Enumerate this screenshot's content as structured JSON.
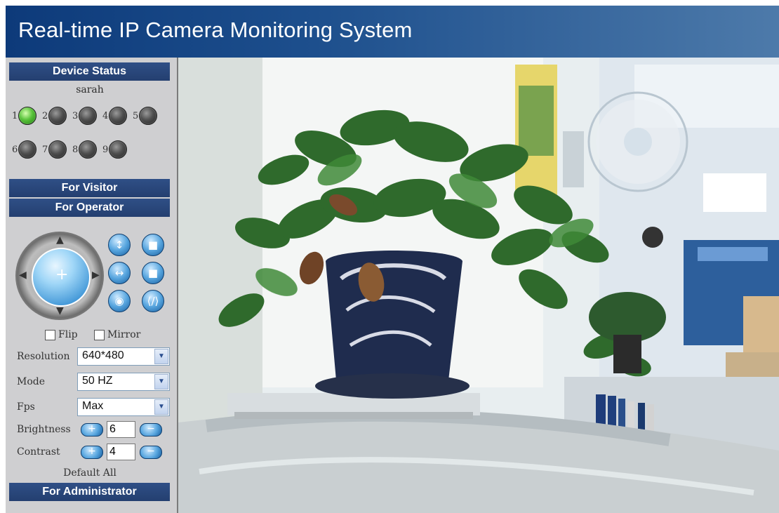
{
  "app": {
    "title": "Real-time IP Camera Monitoring System"
  },
  "sidebar": {
    "device_status": {
      "header": "Device Status",
      "user": "sarah",
      "devices": [
        {
          "num": "1",
          "status": "online"
        },
        {
          "num": "2",
          "status": "offline"
        },
        {
          "num": "3",
          "status": "offline"
        },
        {
          "num": "4",
          "status": "offline"
        },
        {
          "num": "5",
          "status": "offline"
        },
        {
          "num": "6",
          "status": "offline"
        },
        {
          "num": "7",
          "status": "offline"
        },
        {
          "num": "8",
          "status": "offline"
        },
        {
          "num": "9",
          "status": "offline"
        }
      ]
    },
    "for_visitor": "For Visitor",
    "for_operator": "For Operator",
    "for_administrator": "For Administrator",
    "operator": {
      "flip_label": "Flip",
      "mirror_label": "Mirror",
      "resolution_label": "Resolution",
      "resolution_value": "640*480",
      "mode_label": "Mode",
      "mode_value": "50 HZ",
      "fps_label": "Fps",
      "fps_value": "Max",
      "brightness_label": "Brightness",
      "brightness_value": "6",
      "contrast_label": "Contrast",
      "contrast_value": "4",
      "default_all": "Default All"
    }
  },
  "icons": {
    "ptz": "ptz-joystick-icon",
    "vertical_patrol": "vertical-patrol-icon",
    "horizontal_patrol": "horizontal-patrol-icon",
    "stop": "stop-icon",
    "io_on": "io-on-icon",
    "io_off": "io-off-icon",
    "plus": "plus-icon",
    "minus": "minus-icon"
  },
  "colors": {
    "header_bar": "#1d4f8d",
    "section_header": "#2f4f86",
    "sidebar_bg": "#cfcfd1",
    "led_online": "#58c23a",
    "led_offline": "#4f4f4f"
  }
}
